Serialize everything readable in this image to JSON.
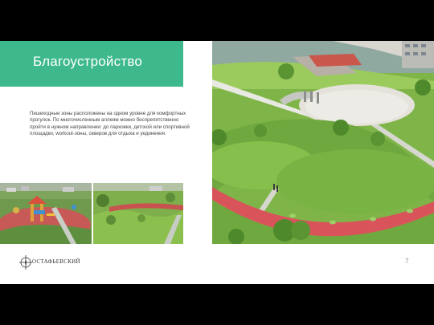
{
  "slide": {
    "title": "Благоустройство",
    "description": "Пешеходные зоны расположены на одном уровне для комфортных прогулок. По многочисленным аллеям можно беспрепятственно пройти в нужном направлении: до парковки, детской или спортивной площадки, workout-зоны, скверов для отдыха и уединения.",
    "page_number": "7"
  },
  "logo": {
    "text": "ОСТАФЬЕВСКИЙ",
    "icon": "compass-star-icon"
  },
  "images": {
    "playground": "playground-photo",
    "park": "park-photo",
    "aerial": "aerial-courtyard-render"
  },
  "colors": {
    "accent": "#3db98c",
    "background": "#ffffff",
    "letterbox": "#000000"
  }
}
